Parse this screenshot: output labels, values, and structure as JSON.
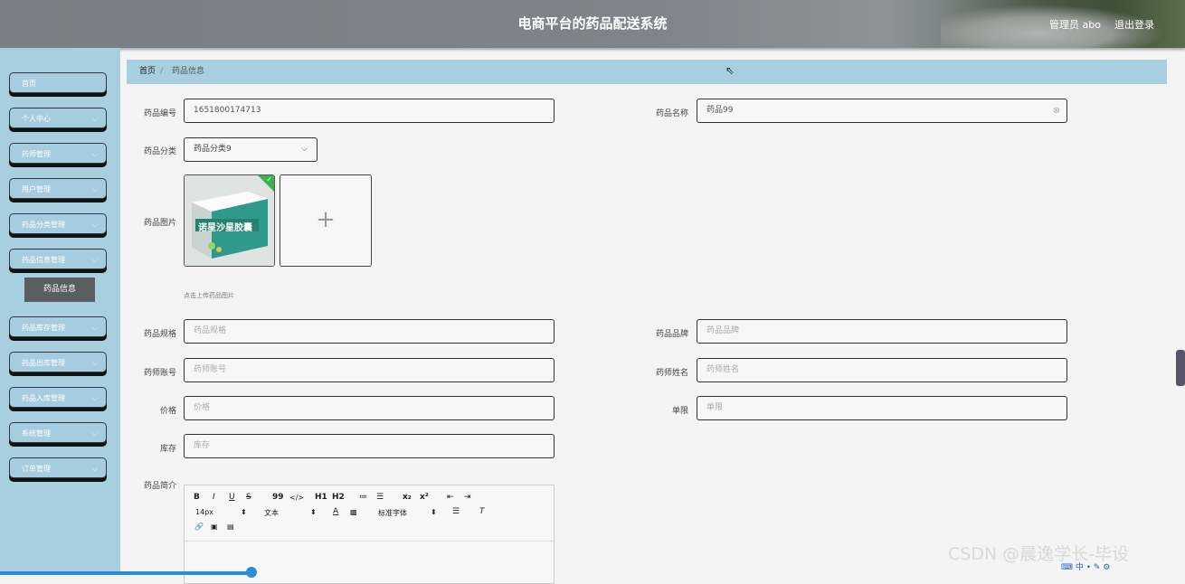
{
  "header": {
    "title": "电商平台的药品配送系统",
    "admin_label": "管理员 abo",
    "logout_label": "退出登录"
  },
  "sidebar": {
    "items": [
      {
        "label": "首页",
        "has_children": false
      },
      {
        "label": "个人中心",
        "has_children": true
      },
      {
        "label": "药师管理",
        "has_children": true
      },
      {
        "label": "用户管理",
        "has_children": true
      },
      {
        "label": "药品分类管理",
        "has_children": true
      },
      {
        "label": "药品信息管理",
        "has_children": true
      },
      {
        "label": "药品库存管理",
        "has_children": true
      },
      {
        "label": "药品出库管理",
        "has_children": true
      },
      {
        "label": "药品入库管理",
        "has_children": true
      },
      {
        "label": "系统管理",
        "has_children": true
      },
      {
        "label": "订单管理",
        "has_children": true
      }
    ],
    "sub_item": "药品信息"
  },
  "breadcrumb": {
    "home": "首页",
    "separator": "/",
    "current": "药品信息"
  },
  "form": {
    "code": {
      "label": "药品编号",
      "value": "1651800174713"
    },
    "name": {
      "label": "药品名称",
      "value": "药品99"
    },
    "category": {
      "label": "药品分类",
      "value": "药品分类9"
    },
    "image": {
      "label": "药品图片",
      "hint": "点击上传药品图片",
      "package_text": "诺星沙星胶囊"
    },
    "spec": {
      "label": "药品规格",
      "placeholder": "药品规格"
    },
    "brand": {
      "label": "药品品牌",
      "placeholder": "药品品牌"
    },
    "pharmacist_account": {
      "label": "药师账号",
      "placeholder": "药师账号"
    },
    "pharmacist_name": {
      "label": "药师姓名",
      "placeholder": "药师姓名"
    },
    "price": {
      "label": "价格",
      "placeholder": "价格"
    },
    "limit": {
      "label": "单限",
      "placeholder": "单限"
    },
    "stock": {
      "label": "库存",
      "placeholder": "库存"
    },
    "intro": {
      "label": "药品简介"
    }
  },
  "editor": {
    "row1": [
      "B",
      "I",
      "U",
      "S",
      "99",
      "</>",
      "H1",
      "H2",
      "≔",
      "☰",
      "x₂",
      "x²",
      "⇤",
      "⇥"
    ],
    "font_size": "14px",
    "text_type": "文本",
    "font_family": "标准字体",
    "row3": [
      "🔗",
      "▣",
      "▤"
    ]
  },
  "watermark": "CSDN @晨逸学长-毕设",
  "colors": {
    "sidebar": "#a7cfe0",
    "header": "#7d848b",
    "accent": "#2a8ddc"
  }
}
